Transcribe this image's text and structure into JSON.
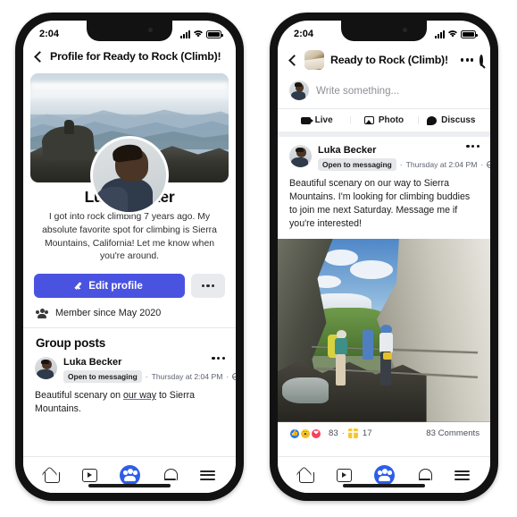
{
  "meta": {
    "accent": "#4a53e0",
    "nav_active": "#2e5ee8",
    "bg": "#ffffff"
  },
  "status_bar": {
    "time": "2:04",
    "signal_icon": "signal-bars-icon",
    "wifi_icon": "wifi-icon",
    "battery_icon": "battery-icon"
  },
  "left_phone": {
    "header": {
      "back_icon": "chevron-left-icon",
      "title": "Profile for Ready to Rock (Climb)!"
    },
    "cover": {
      "alt": "mountain-range-cover-photo"
    },
    "avatar": {
      "alt": "profile-avatar-photo"
    },
    "profile": {
      "name": "Luka Becker",
      "bio": "I got into rock climbing 7 years ago. My absolute favorite spot for climbing is Sierra Mountains, California! Let me know when you're around."
    },
    "actions": {
      "edit_profile_label": "Edit profile",
      "edit_profile_icon": "pencil-icon",
      "more_icon": "ellipsis-icon"
    },
    "membership": {
      "icon": "group-members-icon",
      "text": "Member since May 2020"
    },
    "section_title": "Group posts",
    "post": {
      "author": "Luka Becker",
      "badge": "Open to messaging",
      "separator": "·",
      "timestamp": "Thursday at 2:04 PM",
      "audience_icon": "globe-icon",
      "more_icon": "ellipsis-icon",
      "text_plain": "Beautiful scenary on ",
      "text_link": "our way",
      "text_tail": " to Sierra Mountains."
    }
  },
  "right_phone": {
    "header": {
      "back_icon": "chevron-left-icon",
      "group_avatar": "group-avatar-image",
      "title": "Ready to Rock (Climb)!",
      "more_icon": "ellipsis-icon",
      "search_icon": "search-icon"
    },
    "composer": {
      "avatar": "composer-avatar",
      "placeholder": "Write something...",
      "tabs": [
        {
          "label": "Live",
          "icon": "live-video-icon"
        },
        {
          "label": "Photo",
          "icon": "photo-icon"
        },
        {
          "label": "Discuss",
          "icon": "discuss-icon"
        }
      ]
    },
    "post": {
      "author": "Luka Becker",
      "badge": "Open to messaging",
      "separator": "·",
      "timestamp": "Thursday at 2:04 PM",
      "audience_icon": "globe-icon",
      "more_icon": "ellipsis-icon",
      "text": "Beautiful scenary on our way to Sierra Mountains. I'm looking for climbing buddies to join me next Saturday. Message me if you're interested!",
      "photo_alt": "via-ferrata-climbers-photo"
    },
    "engagement": {
      "reactions": [
        {
          "name": "like-reaction-icon",
          "color": "#1977f3"
        },
        {
          "name": "wow-reaction-icon",
          "color": "#f7bb2f"
        },
        {
          "name": "love-reaction-icon",
          "color": "#f3425f"
        }
      ],
      "reaction_count": "83",
      "separator": "·",
      "gift_icon": "gift-icon",
      "gift_count": "17",
      "comments": "83 Comments"
    }
  },
  "bottom_nav": {
    "items": [
      {
        "name": "nav-home",
        "icon": "home-icon",
        "active": false
      },
      {
        "name": "nav-watch",
        "icon": "video-play-icon",
        "active": false
      },
      {
        "name": "nav-groups",
        "icon": "groups-icon",
        "active": true
      },
      {
        "name": "nav-notifications",
        "icon": "bell-icon",
        "active": false
      },
      {
        "name": "nav-menu",
        "icon": "hamburger-menu-icon",
        "active": false
      }
    ]
  }
}
